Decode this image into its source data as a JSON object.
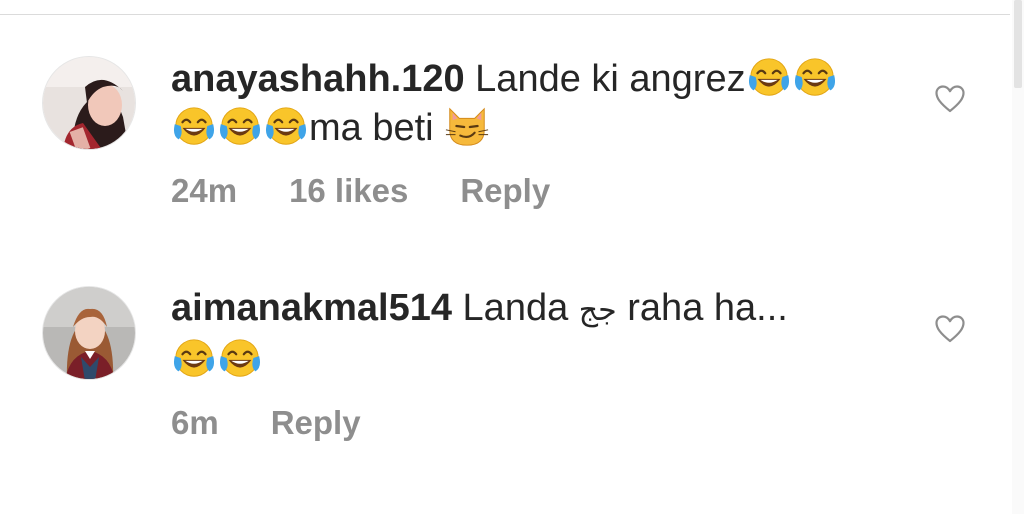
{
  "comments": [
    {
      "username": "anayashahh.120",
      "text_1": "Lande ki angrez",
      "text_2": "ma beti",
      "time": "24m",
      "likes": "16 likes",
      "reply": "Reply"
    },
    {
      "username": "aimanakmal514",
      "text_1": "Landa",
      "arabic": "جج",
      "text_2": "raha ha...",
      "time": "6m",
      "reply": "Reply"
    }
  ],
  "icons": {
    "like": "heart-outline-icon",
    "laugh": "face-with-tears-of-joy-emoji",
    "cat": "smirking-cat-emoji"
  },
  "colors": {
    "text": "#262626",
    "meta": "#8e8e8e",
    "heart": "#8e8e8e",
    "emoji_face": "#f9c52a"
  }
}
